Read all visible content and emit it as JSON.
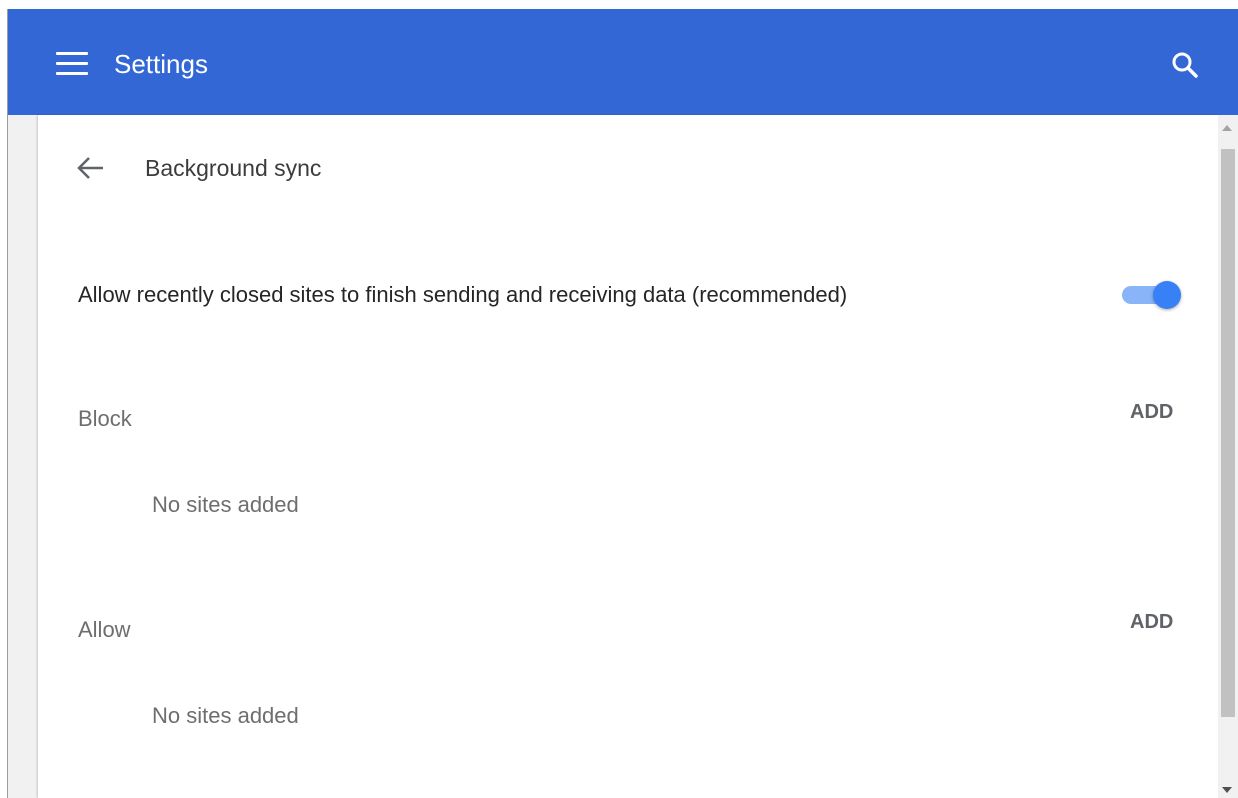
{
  "header": {
    "title": "Settings",
    "menu_icon": "hamburger-menu-icon",
    "search_icon": "search-icon",
    "background_color": "#3367d6"
  },
  "subpage": {
    "title": "Background sync",
    "back_icon": "arrow-back-icon"
  },
  "setting": {
    "label": "Allow recently closed sites to finish sending and receiving data (recommended)",
    "toggle_on": true,
    "toggle_color": "#3880f5"
  },
  "sections": [
    {
      "label": "Block",
      "add_label": "ADD",
      "empty_text": "No sites added"
    },
    {
      "label": "Allow",
      "add_label": "ADD",
      "empty_text": "No sites added"
    }
  ]
}
